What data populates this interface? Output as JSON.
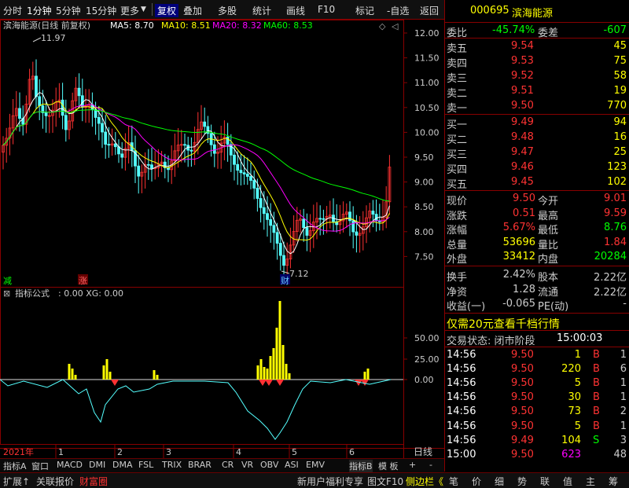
{
  "toolbar": {
    "items": [
      "分时",
      "1分钟",
      "5分钟",
      "15分钟",
      "更多",
      "复权",
      "叠加",
      "多股",
      "统计",
      "画线",
      "F10",
      "-自选",
      "返回"
    ]
  },
  "chart": {
    "title": "滨海能源(日线 前复权)",
    "ma5": "MA5: 8.70",
    "ma10": "MA10: 8.51",
    "ma20": "MA20: 8.32",
    "ma60": "MA60: 8.53",
    "high_label": "11.97",
    "low_label": "7.12",
    "y_ticks": [
      "12.00",
      "11.50",
      "11.00",
      "10.50",
      "10.00",
      "9.50",
      "9.00",
      "8.50",
      "8.00",
      "7.50"
    ],
    "flag_jian": "减",
    "flag_zhang": "涨",
    "flag_cai": "财",
    "indicator_title": "指标公式",
    "indicator_vals": ": 0.00  XG: 0.00",
    "ind_ticks": [
      "50.00",
      "25.00",
      "0.00"
    ],
    "x_year": "2021年",
    "x_months": [
      "1",
      "2",
      "3",
      "4",
      "5",
      "6"
    ],
    "period": "日线",
    "colors": {
      "up": "#ff3232",
      "down": "#54ffff",
      "ma5": "#ffffff",
      "ma10": "#ffff00",
      "ma20": "#ff00ff",
      "ma60": "#00ff00"
    }
  },
  "tabs": [
    "指标A",
    "窗口",
    "MACD",
    "DMI",
    "DMA",
    "FSL",
    "TRIX",
    "BRAR",
    "CR",
    "VR",
    "OBV",
    "ASI",
    "EMV",
    "指标B",
    "模 板",
    "+",
    "-"
  ],
  "quote": {
    "code": "000695",
    "name": "滨海能源",
    "weibi_label": "委比",
    "weibi": "-45.74%",
    "weicha_label": "委差",
    "weicha": "-607",
    "asks": [
      {
        "label": "卖五",
        "price": "9.54",
        "vol": "45"
      },
      {
        "label": "卖四",
        "price": "9.53",
        "vol": "75"
      },
      {
        "label": "卖三",
        "price": "9.52",
        "vol": "58"
      },
      {
        "label": "卖二",
        "price": "9.51",
        "vol": "19"
      },
      {
        "label": "卖一",
        "price": "9.50",
        "vol": "770"
      }
    ],
    "bids": [
      {
        "label": "买一",
        "price": "9.49",
        "vol": "94"
      },
      {
        "label": "买二",
        "price": "9.48",
        "vol": "16"
      },
      {
        "label": "买三",
        "price": "9.47",
        "vol": "25"
      },
      {
        "label": "买四",
        "price": "9.46",
        "vol": "123"
      },
      {
        "label": "买五",
        "price": "9.45",
        "vol": "102"
      }
    ],
    "stats": [
      {
        "l1": "现价",
        "v1": "9.50",
        "l2": "今开",
        "v2": "9.01"
      },
      {
        "l1": "涨跌",
        "v1": "0.51",
        "l2": "最高",
        "v2": "9.59"
      },
      {
        "l1": "涨幅",
        "v1": "5.67%",
        "l2": "最低",
        "v2": "8.76"
      },
      {
        "l1": "总量",
        "v1": "53696",
        "l2": "量比",
        "v2": "1.84"
      },
      {
        "l1": "外盘",
        "v1": "33412",
        "l2": "内盘",
        "v2": "20284"
      }
    ],
    "stats2": [
      {
        "l1": "换手",
        "v1": "2.42%",
        "l2": "股本",
        "v2": "2.22亿"
      },
      {
        "l1": "净资",
        "v1": "1.28",
        "l2": "流通",
        "v2": "2.22亿"
      },
      {
        "l1": "收益(一)",
        "v1": "-0.065",
        "l2": "PE(动)",
        "v2": "-"
      }
    ],
    "promo": "仅需20元查看千档行情",
    "trade_status_label": "交易状态: 闭市阶段",
    "trade_status_time": "15:00:03",
    "ticks": [
      {
        "t": "14:56",
        "p": "9.50",
        "v": "1",
        "d": "B",
        "n": "1"
      },
      {
        "t": "14:56",
        "p": "9.50",
        "v": "220",
        "d": "B",
        "n": "6"
      },
      {
        "t": "14:56",
        "p": "9.50",
        "v": "5",
        "d": "B",
        "n": "1"
      },
      {
        "t": "14:56",
        "p": "9.50",
        "v": "30",
        "d": "B",
        "n": "1"
      },
      {
        "t": "14:56",
        "p": "9.50",
        "v": "73",
        "d": "B",
        "n": "2"
      },
      {
        "t": "14:56",
        "p": "9.50",
        "v": "5",
        "d": "B",
        "n": "1"
      },
      {
        "t": "14:56",
        "p": "9.49",
        "v": "104",
        "d": "S",
        "n": "3"
      },
      {
        "t": "15:00",
        "p": "9.50",
        "v": "623",
        "d": "",
        "n": "48"
      }
    ]
  },
  "bottom": {
    "left": [
      "扩展↑",
      "关联报价",
      "财富圈"
    ],
    "mid": [
      "新用户福利专享",
      "图文F10",
      "侧边栏《"
    ],
    "right": [
      "笔",
      "价",
      "细",
      "势",
      "联",
      "值",
      "主",
      "筹"
    ]
  }
}
